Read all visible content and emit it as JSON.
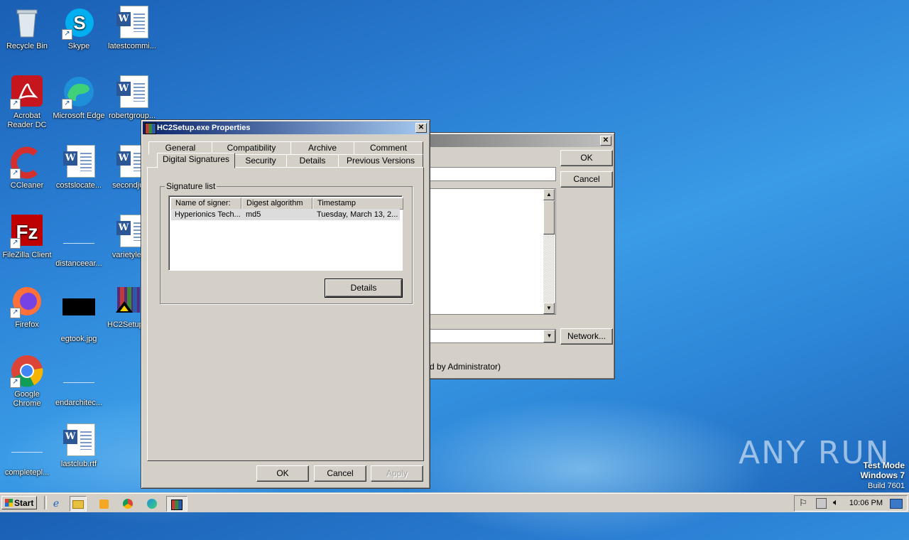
{
  "desktop": {
    "icons": [
      {
        "label": "Recycle Bin"
      },
      {
        "label": "Skype"
      },
      {
        "label": "latestcommi..."
      },
      {
        "label": "Acrobat Reader DC"
      },
      {
        "label": "Microsoft Edge"
      },
      {
        "label": "robertgroup..."
      },
      {
        "label": "CCleaner"
      },
      {
        "label": "costslocate..."
      },
      {
        "label": "secondjul..."
      },
      {
        "label": "FileZilla Client"
      },
      {
        "label": "distanceear..."
      },
      {
        "label": "varietylea..."
      },
      {
        "label": "Firefox"
      },
      {
        "label": "egtook.jpg"
      },
      {
        "label": "HC2Setup..."
      },
      {
        "label": "Google Chrome"
      },
      {
        "label": "endarchitec..."
      },
      {
        "label": "completepl..."
      },
      {
        "label": "lastclub.rtf"
      }
    ],
    "watermark": {
      "brand": "ANY RUN",
      "mode": "Test Mode",
      "os": "Windows 7",
      "build": "Build 7601"
    }
  },
  "back_window": {
    "ok_label": "OK",
    "cancel_label": "Cancel",
    "network_label": "Network...",
    "footer_text": "d by Administrator)"
  },
  "dialog": {
    "title": "HC2Setup.exe Properties",
    "tabs_row1": [
      "General",
      "Compatibility",
      "Archive",
      "Comment"
    ],
    "tabs_row2": [
      "Digital Signatures",
      "Security",
      "Details",
      "Previous Versions"
    ],
    "active_tab": "Digital Signatures",
    "group_title": "Signature list",
    "columns": [
      "Name of signer:",
      "Digest algorithm",
      "Timestamp"
    ],
    "rows": [
      {
        "signer": "Hyperionics Tech...",
        "digest": "md5",
        "timestamp": "Tuesday, March 13, 2..."
      }
    ],
    "details_label": "Details",
    "ok_label": "OK",
    "cancel_label": "Cancel",
    "apply_label": "Apply"
  },
  "taskbar": {
    "start_label": "Start",
    "clock": "10:06 PM"
  }
}
